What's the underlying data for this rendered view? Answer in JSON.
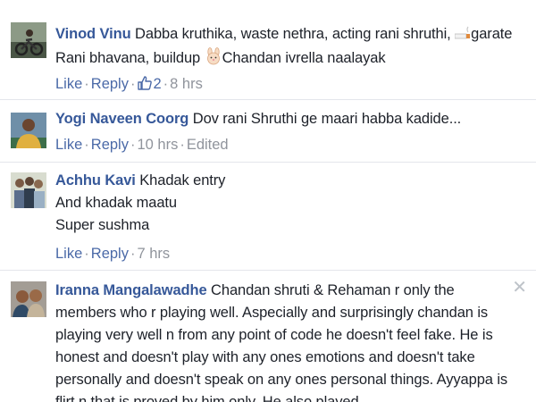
{
  "comments": [
    {
      "author": "Vinod Vinu",
      "text_part1": "Dabba kruthika, waste nethra, acting rani shruthi, ",
      "emoji1": "cigarette-icon",
      "text_part2": "garate Rani bhavana, buildup ",
      "emoji2": "rabbit-face-icon",
      "text_part3": "Chandan ivrella naalayak",
      "like": "Like",
      "reply": "Reply",
      "like_count": "2",
      "time": "8 hrs"
    },
    {
      "author": "Yogi Naveen Coorg",
      "text": "Dov rani Shruthi ge maari habba kadide...",
      "like": "Like",
      "reply": "Reply",
      "time": "10 hrs",
      "edited": "Edited"
    },
    {
      "author": "Achhu Kavi",
      "line1": "Khadak entry",
      "line2": "And khadak maatu",
      "line3": "Super sushma",
      "like": "Like",
      "reply": "Reply",
      "time": "7 hrs"
    },
    {
      "author": "Iranna Mangalawadhe",
      "text": "Chandan shruti & Rehaman r only the members who r playing well. Aspecially and surprisingly chandan is playing very well n from any point of code he doesn't feel fake. He is honest and doesn't play with any ones emotions and doesn't take personally and doesn't speak on any ones personal things. Ayyappa is flirt n that is proved by him only. He also played"
    }
  ],
  "colors": {
    "author": "#365899",
    "link": "#4b6aa8",
    "meta": "#90949c",
    "text": "#1d2129",
    "divider": "#e4e6eb"
  }
}
